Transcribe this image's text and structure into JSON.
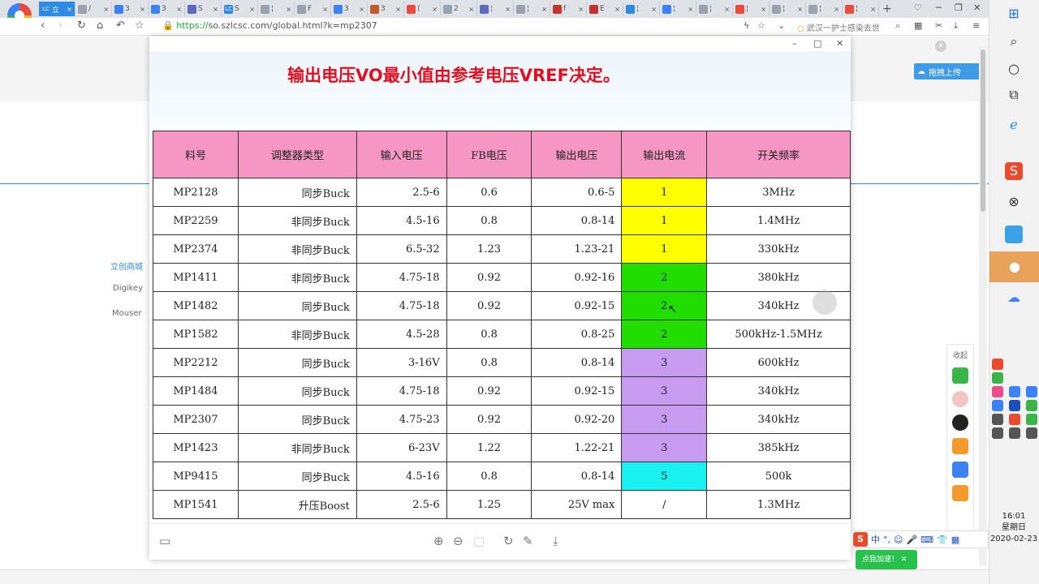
{
  "browser": {
    "tabs": [
      {
        "label": "立",
        "fav": "LC",
        "color": "#2f8ae5"
      },
      {
        "label": "/",
        "fav": "",
        "color": "#9aa3ad"
      },
      {
        "label": "3",
        "fav": "",
        "color": "#3b82f6"
      },
      {
        "label": "3",
        "fav": "",
        "color": "#3b82f6"
      },
      {
        "label": "S",
        "fav": "",
        "color": "#5b6abf"
      },
      {
        "label": "S",
        "fav": "LC",
        "color": "#2f8ae5"
      },
      {
        "label": "¦",
        "fav": "",
        "color": "#9aa3ad"
      },
      {
        "label": "F",
        "fav": "",
        "color": "#9aa3ad"
      },
      {
        "label": "3",
        "fav": "",
        "color": "#3b82f6"
      },
      {
        "label": "3",
        "fav": "",
        "color": "#c05a2a"
      },
      {
        "label": "(",
        "fav": "",
        "color": "#e94b3c"
      },
      {
        "label": "2",
        "fav": "",
        "color": "#9aa3ad"
      },
      {
        "label": "¦",
        "fav": "",
        "color": "#5b6abf"
      },
      {
        "label": "¦",
        "fav": "",
        "color": "#9aa3ad"
      },
      {
        "label": "f",
        "fav": "",
        "color": "#c4302b"
      },
      {
        "label": "E",
        "fav": "",
        "color": "#c4302b"
      },
      {
        "label": "¦",
        "fav": "",
        "color": "#2f8ae5"
      },
      {
        "label": "¦",
        "fav": "",
        "color": "#3b82f6"
      },
      {
        "label": "¦",
        "fav": "",
        "color": "#9aa3ad"
      },
      {
        "label": "¦",
        "fav": "",
        "color": "#e94b3c"
      },
      {
        "label": "¦",
        "fav": "",
        "color": "#9aa3ad"
      },
      {
        "label": "¦",
        "fav": "",
        "color": "#9aa3ad"
      },
      {
        "label": "¦",
        "fav": "",
        "color": "#e94b3c"
      }
    ],
    "url_protocol": "https://",
    "url_rest": "so.szlcsc.com/global.html?k=mp2307",
    "news_text": "武汉一护士感染去世"
  },
  "background_page": {
    "side_links": [
      "立创商城",
      "Digikey",
      "Mouser"
    ],
    "upload_button": "拖拽上传"
  },
  "viewer": {
    "slide_title": "输出电压VO最小值由参考电压VREF决定。",
    "headers": [
      "料号",
      "调整器类型",
      "输入电压",
      "FB电压",
      "输出电压",
      "输出电流",
      "开关频率"
    ],
    "rows": [
      {
        "part": "MP2128",
        "type": "同步Buck",
        "vin": "2.5-6",
        "fb": "0.6",
        "vout": "0.6-5",
        "iout": "1",
        "freq": "3MHz",
        "color": "#ffff00"
      },
      {
        "part": "MP2259",
        "type": "非同步Buck",
        "vin": "4.5-16",
        "fb": "0.8",
        "vout": "0.8-14",
        "iout": "1",
        "freq": "1.4MHz",
        "color": "#ffff00"
      },
      {
        "part": "MP2374",
        "type": "非同步Buck",
        "vin": "6.5-32",
        "fb": "1.23",
        "vout": "1.23-21",
        "iout": "1",
        "freq": "330kHz",
        "color": "#ffff00"
      },
      {
        "part": "MP1411",
        "type": "非同步Buck",
        "vin": "4.75-18",
        "fb": "0.92",
        "vout": "0.92-16",
        "iout": "2",
        "freq": "380kHz",
        "color": "#22dd00"
      },
      {
        "part": "MP1482",
        "type": "同步Buck",
        "vin": "4.75-18",
        "fb": "0.92",
        "vout": "0.92-15",
        "iout": "2",
        "freq": "340kHz",
        "color": "#22dd00"
      },
      {
        "part": "MP1582",
        "type": "非同步Buck",
        "vin": "4.5-28",
        "fb": "0.8",
        "vout": "0.8-25",
        "iout": "2",
        "freq": "500kHz-1.5MHz",
        "color": "#22dd00"
      },
      {
        "part": "MP2212",
        "type": "同步Buck",
        "vin": "3-16V",
        "fb": "0.8",
        "vout": "0.8-14",
        "iout": "3",
        "freq": "600kHz",
        "color": "#c79cf0"
      },
      {
        "part": "MP1484",
        "type": "同步Buck",
        "vin": "4.75-18",
        "fb": "0.92",
        "vout": "0.92-15",
        "iout": "3",
        "freq": "340kHz",
        "color": "#c79cf0"
      },
      {
        "part": "MP2307",
        "type": "同步Buck",
        "vin": "4.75-23",
        "fb": "0.92",
        "vout": "0.92-20",
        "iout": "3",
        "freq": "340kHz",
        "color": "#c79cf0"
      },
      {
        "part": "MP1423",
        "type": "非同步Buck",
        "vin": "6-23V",
        "fb": "1.22",
        "vout": "1.22-21",
        "iout": "3",
        "freq": "385kHz",
        "color": "#c79cf0"
      },
      {
        "part": "MP9415",
        "type": "同步Buck",
        "vin": "4.5-16",
        "fb": "0.8",
        "vout": "0.8-14",
        "iout": "5",
        "freq": "500k",
        "color": "#19f0f0"
      },
      {
        "part": "MP1541",
        "type": "升压Boost",
        "vin": "2.5-6",
        "fb": "1.25",
        "vout": "25V max",
        "iout": "/",
        "freq": "1.3MHz",
        "color": "#ffffff"
      }
    ]
  },
  "right_panel": {
    "collapse_label": "收起"
  },
  "ime": {
    "lang": "中",
    "toast": "点我加速！"
  },
  "taskbar": {
    "time": "16:01",
    "weekday": "星期日",
    "date": "2020-02-23"
  }
}
